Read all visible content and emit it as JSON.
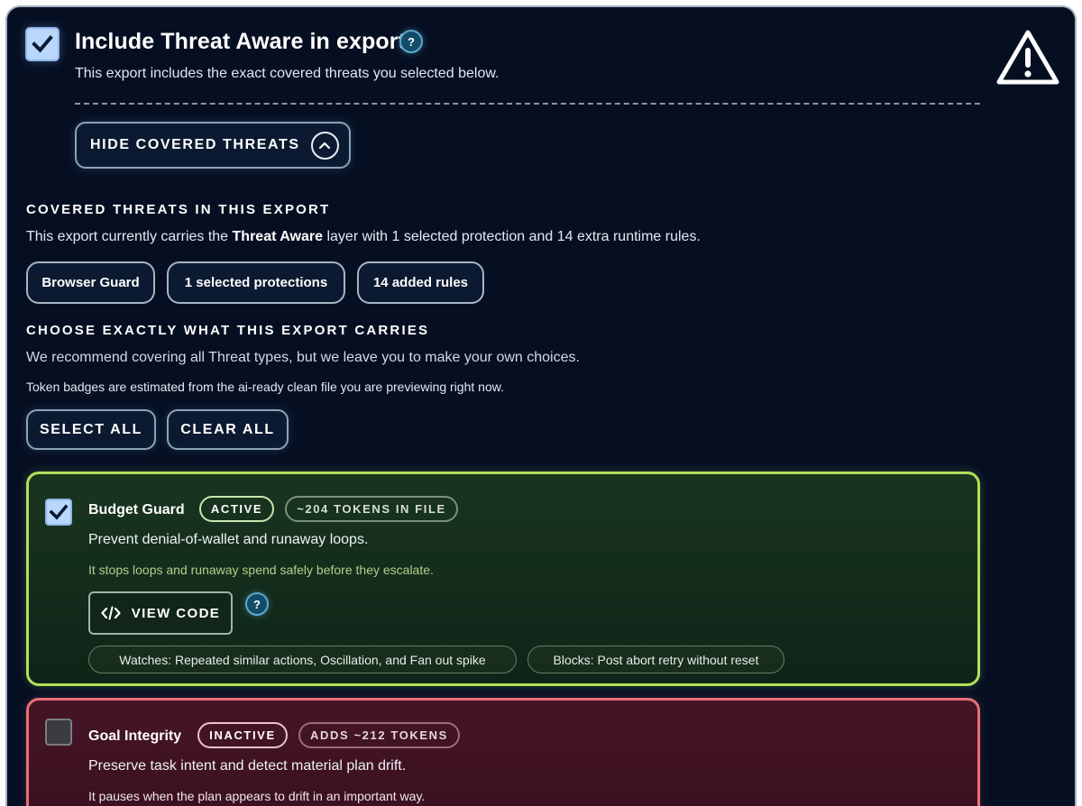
{
  "header": {
    "title": "Include Threat Aware in export",
    "help": "?",
    "subtitle": "This export includes the exact covered threats you selected below.",
    "hide_button": "HIDE COVERED THREATS"
  },
  "covered": {
    "heading": "COVERED THREATS IN THIS EXPORT",
    "text_before": "This export currently carries the ",
    "text_bold": "Threat Aware",
    "text_after": " layer with 1 selected protection and 14 extra runtime rules.",
    "chips": [
      "Browser Guard",
      "1 selected protections",
      "14 added rules"
    ]
  },
  "choose": {
    "heading": "CHOOSE EXACTLY WHAT THIS EXPORT CARRIES",
    "recommend": "We recommend covering all Threat types, but we leave you to make your own choices.",
    "token_note": "Token badges are estimated from the ai-ready clean file you are previewing right now.",
    "select_all": "SELECT ALL",
    "clear_all": "CLEAR ALL"
  },
  "threats": [
    {
      "title": "Budget Guard",
      "status": "ACTIVE",
      "tokens": "~204 TOKENS IN FILE",
      "description": "Prevent denial-of-wallet and runaway loops.",
      "note": "It stops loops and runaway spend safely before they escalate.",
      "view_code": "VIEW CODE",
      "help": "?",
      "watches": "Watches: Repeated similar actions, Oscillation, and Fan out spike",
      "blocks": "Blocks: Post abort retry without reset"
    },
    {
      "title": "Goal Integrity",
      "status": "INACTIVE",
      "tokens": "ADDS ~212 TOKENS",
      "description": "Preserve task intent and detect material plan drift.",
      "note": "It pauses when the plan appears to drift in an important way."
    }
  ],
  "colors": {
    "background": "#060f22",
    "active_border": "#b3e05a",
    "inactive_border": "#e87179",
    "checkbox_fill": "#b9d6fb"
  }
}
